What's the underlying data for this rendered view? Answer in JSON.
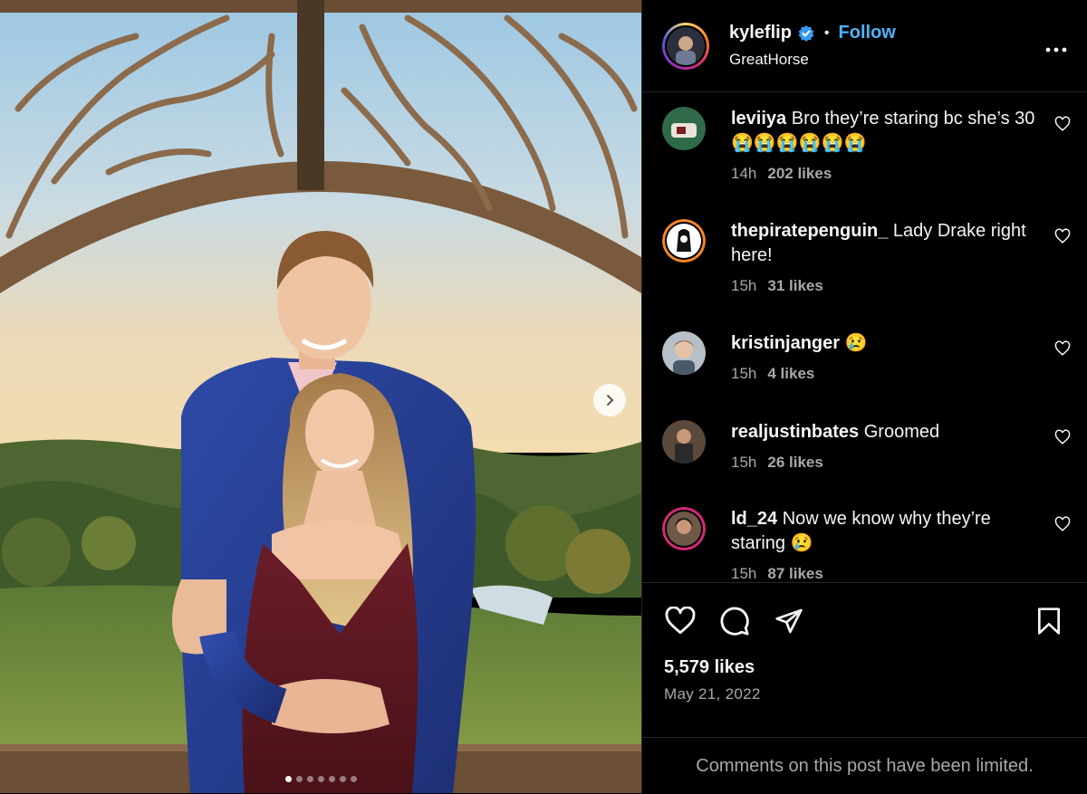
{
  "header": {
    "username": "kyleflip",
    "verified_icon": "verified-badge-icon",
    "separator": "•",
    "follow_label": "Follow",
    "location": "GreatHorse",
    "more_icon": "more-options-icon"
  },
  "media": {
    "next_icon": "chevron-right-icon",
    "carousel_count": 7,
    "active_index": 0
  },
  "comments": [
    {
      "username": "leviiya",
      "text": "Bro they’re staring bc she’s 30 😭😭😭😭😭😭",
      "time": "14h",
      "likes": "202 likes"
    },
    {
      "username": "thepiratepenguin_",
      "text": "Lady Drake right here!",
      "time": "15h",
      "likes": "31 likes"
    },
    {
      "username": "kristinjanger",
      "text": "😢",
      "time": "15h",
      "likes": "4 likes"
    },
    {
      "username": "realjustinbates",
      "text": "Groomed",
      "time": "15h",
      "likes": "26 likes"
    },
    {
      "username": "ld_24",
      "text": "Now we know why they’re staring 😢",
      "time": "15h",
      "likes": "87 likes"
    }
  ],
  "actions": {
    "like_icon": "heart-icon",
    "comment_icon": "comment-icon",
    "share_icon": "share-icon",
    "save_icon": "bookmark-icon",
    "likes_count": "5,579 likes",
    "date": "May 21, 2022",
    "limited_notice": "Comments on this post have been limited."
  },
  "colors": {
    "background": "#000000",
    "accent": "#4cb5f9",
    "muted": "#a8a8a8",
    "divider": "#262626"
  }
}
